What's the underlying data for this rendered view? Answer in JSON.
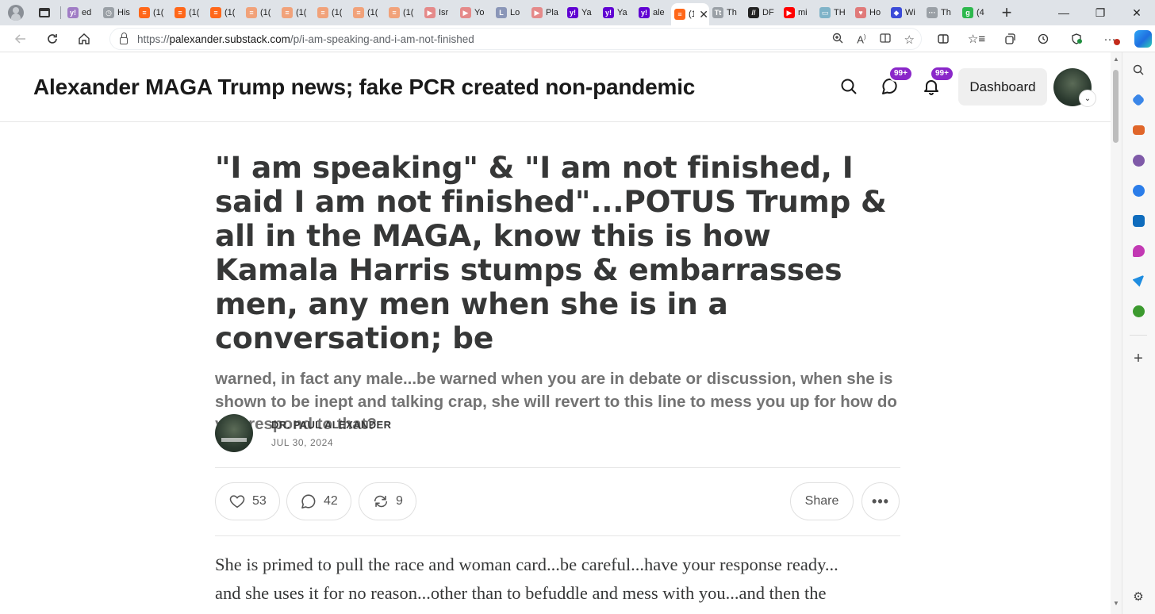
{
  "browser": {
    "tabs": [
      {
        "title": "ed",
        "icon": "yahoo-icon",
        "color": "#a07cc5"
      },
      {
        "title": "His",
        "icon": "history-icon",
        "color": "#9aa0a6"
      },
      {
        "title": "(1(",
        "icon": "substack-icon",
        "color": "#ff6719"
      },
      {
        "title": "(1(",
        "icon": "substack-icon",
        "color": "#ff6719"
      },
      {
        "title": "(1(",
        "icon": "substack-icon",
        "color": "#ff6719"
      },
      {
        "title": "(1(",
        "icon": "substack-icon",
        "color": "#f1a27a"
      },
      {
        "title": "(1(",
        "icon": "substack-icon",
        "color": "#f1a27a"
      },
      {
        "title": "(1(",
        "icon": "substack-icon",
        "color": "#f1a27a"
      },
      {
        "title": "(1(",
        "icon": "substack-icon",
        "color": "#f1a27a"
      },
      {
        "title": "(1(",
        "icon": "substack-icon",
        "color": "#f1a27a"
      },
      {
        "title": "Isr",
        "icon": "youtube-icon",
        "color": "#e58a8a"
      },
      {
        "title": "Yo",
        "icon": "youtube-icon",
        "color": "#e58a8a"
      },
      {
        "title": "Lo",
        "icon": "letter-l-icon",
        "color": "#8a96b8"
      },
      {
        "title": "Pla",
        "icon": "youtube-icon",
        "color": "#e58a8a"
      },
      {
        "title": "Ya",
        "icon": "yahoo-icon",
        "color": "#6001d2"
      },
      {
        "title": "Ya",
        "icon": "yahoo-icon",
        "color": "#6001d2"
      },
      {
        "title": "ale",
        "icon": "yahoo-icon",
        "color": "#6001d2"
      },
      {
        "title": "(1(",
        "icon": "substack-icon",
        "color": "#ff6719",
        "active": true
      },
      {
        "title": "Th",
        "icon": "tt-icon",
        "color": "#9aa0a6"
      },
      {
        "title": "DF",
        "icon": "df-icon",
        "color": "#222222"
      },
      {
        "title": "mi",
        "icon": "youtube-icon",
        "color": "#ff0000"
      },
      {
        "title": "TH",
        "icon": "image-icon",
        "color": "#7fb3c8"
      },
      {
        "title": "Ho",
        "icon": "heart-icon",
        "color": "#e07a7a"
      },
      {
        "title": "Wi",
        "icon": "shield-icon",
        "color": "#3b4bd8"
      },
      {
        "title": "Th",
        "icon": "dots-icon",
        "color": "#9aa0a6"
      },
      {
        "title": "(4",
        "icon": "g-icon",
        "color": "#2db84d"
      }
    ],
    "url_prefix": "https://",
    "url_domain": "palexander.substack.com",
    "url_path": "/p/i-am-speaking-and-i-am-not-finished"
  },
  "header": {
    "site_title": "Alexander MAGA Trump news; fake PCR created non-pandemic",
    "chat_badge": "99+",
    "notif_badge": "99+",
    "dashboard_label": "Dashboard"
  },
  "post": {
    "title": "\"I am speaking\" & \"I am not finished, I said I am not finished\"...POTUS Trump & all in the MAGA, know this is how Kamala Harris stumps & embarrasses men, any men when she is in a conversation; be",
    "subtitle": "warned, in fact any male...be warned when you are in debate or discussion, when she is shown to be inept and talking crap, she will revert to this line to mess you up for how do you respond to that?",
    "author": "DR. PAUL ALEXANDER",
    "date": "JUL 30, 2024",
    "likes": "53",
    "comments": "42",
    "restacks": "9",
    "share_label": "Share",
    "more_label": "•••",
    "body_line_1": "She is primed to pull the race and woman card...be careful...have your response ready...",
    "body_line_2": "and she uses it for no reason...other than to befuddle and mess with you...and then the"
  }
}
